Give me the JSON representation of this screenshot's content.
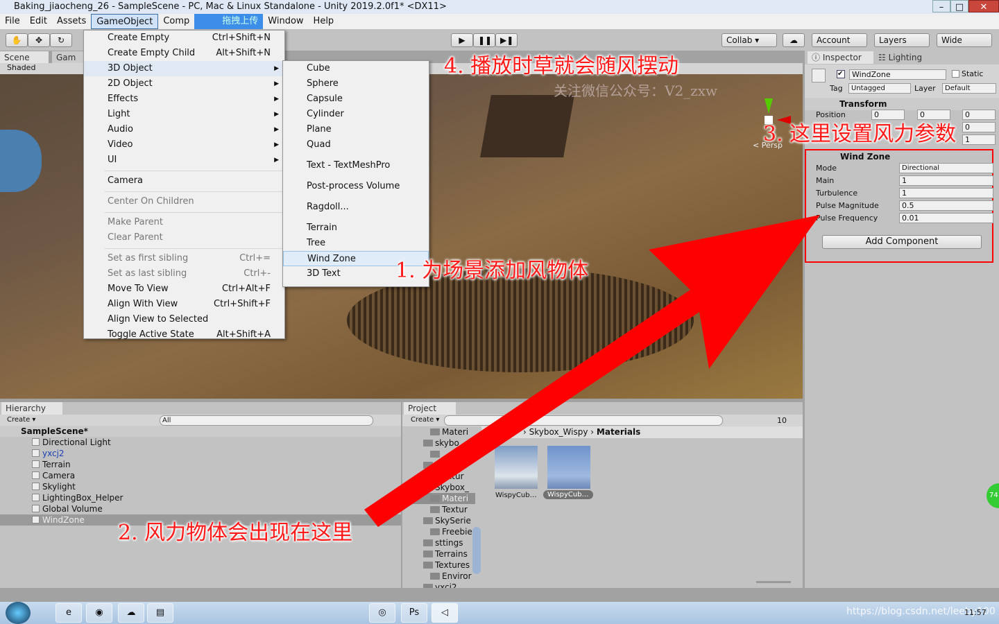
{
  "window": {
    "title": "Baking_jiaocheng_26 - SampleScene - PC, Mac & Linux Standalone - Unity 2019.2.0f1* <DX11>"
  },
  "menubar": [
    "File",
    "Edit",
    "Assets",
    "GameObject",
    "Comp",
    "拖拽上传",
    "Window",
    "Help"
  ],
  "toolbar": {
    "collab": "Collab ▾",
    "account": "Account",
    "layers": "Layers",
    "layout": "Wide"
  },
  "scene": {
    "tabs": [
      "Scene",
      "Gam"
    ],
    "shading": "Shaded",
    "persp": "< Persp",
    "watermark": "关注微信公众号：V2_zxw"
  },
  "gameobject_menu": [
    {
      "label": "Create Empty",
      "shortcut": "Ctrl+Shift+N"
    },
    {
      "label": "Create Empty Child",
      "shortcut": "Alt+Shift+N"
    },
    {
      "label": "3D Object",
      "submenu": true
    },
    {
      "label": "2D Object",
      "submenu": true
    },
    {
      "label": "Effects",
      "submenu": true
    },
    {
      "label": "Light",
      "submenu": true
    },
    {
      "label": "Audio",
      "submenu": true
    },
    {
      "label": "Video",
      "submenu": true
    },
    {
      "label": "UI",
      "submenu": true
    },
    {
      "label": "Camera"
    },
    {
      "label": "Center On Children",
      "disabled": true
    },
    {
      "label": "Make Parent",
      "disabled": true
    },
    {
      "label": "Clear Parent",
      "disabled": true
    },
    {
      "label": "Set as first sibling",
      "shortcut": "Ctrl+=",
      "disabled": true
    },
    {
      "label": "Set as last sibling",
      "shortcut": "Ctrl+-",
      "disabled": true
    },
    {
      "label": "Move To View",
      "shortcut": "Ctrl+Alt+F"
    },
    {
      "label": "Align With View",
      "shortcut": "Ctrl+Shift+F"
    },
    {
      "label": "Align View to Selected"
    },
    {
      "label": "Toggle Active State",
      "shortcut": "Alt+Shift+A"
    }
  ],
  "submenu_3d": [
    "Cube",
    "Sphere",
    "Capsule",
    "Cylinder",
    "Plane",
    "Quad",
    "Text - TextMeshPro",
    "Post-process Volume",
    "Ragdoll...",
    "Terrain",
    "Tree",
    "Wind Zone",
    "3D Text"
  ],
  "inspector": {
    "tabs": [
      "Inspector",
      "Lighting"
    ],
    "name": "WindZone",
    "static": "Static",
    "tag_label": "Tag",
    "tag": "Untagged",
    "layer_label": "Layer",
    "layer": "Default",
    "transform": {
      "title": "Transform",
      "position_label": "Position",
      "x": "0",
      "y": "0",
      "z": "0",
      "r": "0",
      "s": "1"
    },
    "windzone": {
      "title": "Wind Zone",
      "fields": [
        {
          "label": "Mode",
          "value": "Directional"
        },
        {
          "label": "Main",
          "value": "1"
        },
        {
          "label": "Turbulence",
          "value": "1"
        },
        {
          "label": "Pulse Magnitude",
          "value": "0.5"
        },
        {
          "label": "Pulse Frequency",
          "value": "0.01"
        }
      ]
    },
    "add_component": "Add Component"
  },
  "hierarchy": {
    "tab": "Hierarchy",
    "create": "Create ▾",
    "search": "All",
    "scene": "SampleScene*",
    "items": [
      "Directional Light",
      "yxcj2",
      "Terrain",
      "Camera",
      "Skylight",
      "LightingBox_Helper",
      "Global Volume",
      "WindZone"
    ]
  },
  "project": {
    "tab": "Project",
    "create": "Create ▾",
    "hidden_count": "10",
    "tree": [
      "Materi",
      "skybo",
      "",
      "",
      "extur",
      "Skybox_",
      "Materi",
      "Textur",
      "SkySerie",
      "Freebie",
      "sttings",
      "Terrains",
      "Textures",
      "Enviror",
      "yxcj2"
    ],
    "breadcrumb": [
      "Skybox_Wispy",
      "Materials"
    ],
    "assets": [
      "WispyCub…",
      "WispyCub…"
    ]
  },
  "annotations": [
    "4. 播放时草就会随风摆动",
    "3. 这里设置风力参数",
    "1. 为场景添加风物体",
    "2. 风力物体会出现在这里"
  ],
  "taskbar": {
    "watermark": "https://blog.csdn.net/leeby100",
    "time": "11:57",
    "badge": "74"
  },
  "colors": {
    "annotation": "#ff0000",
    "selection": "#3d79d6",
    "panel": "#c2c2c2"
  }
}
